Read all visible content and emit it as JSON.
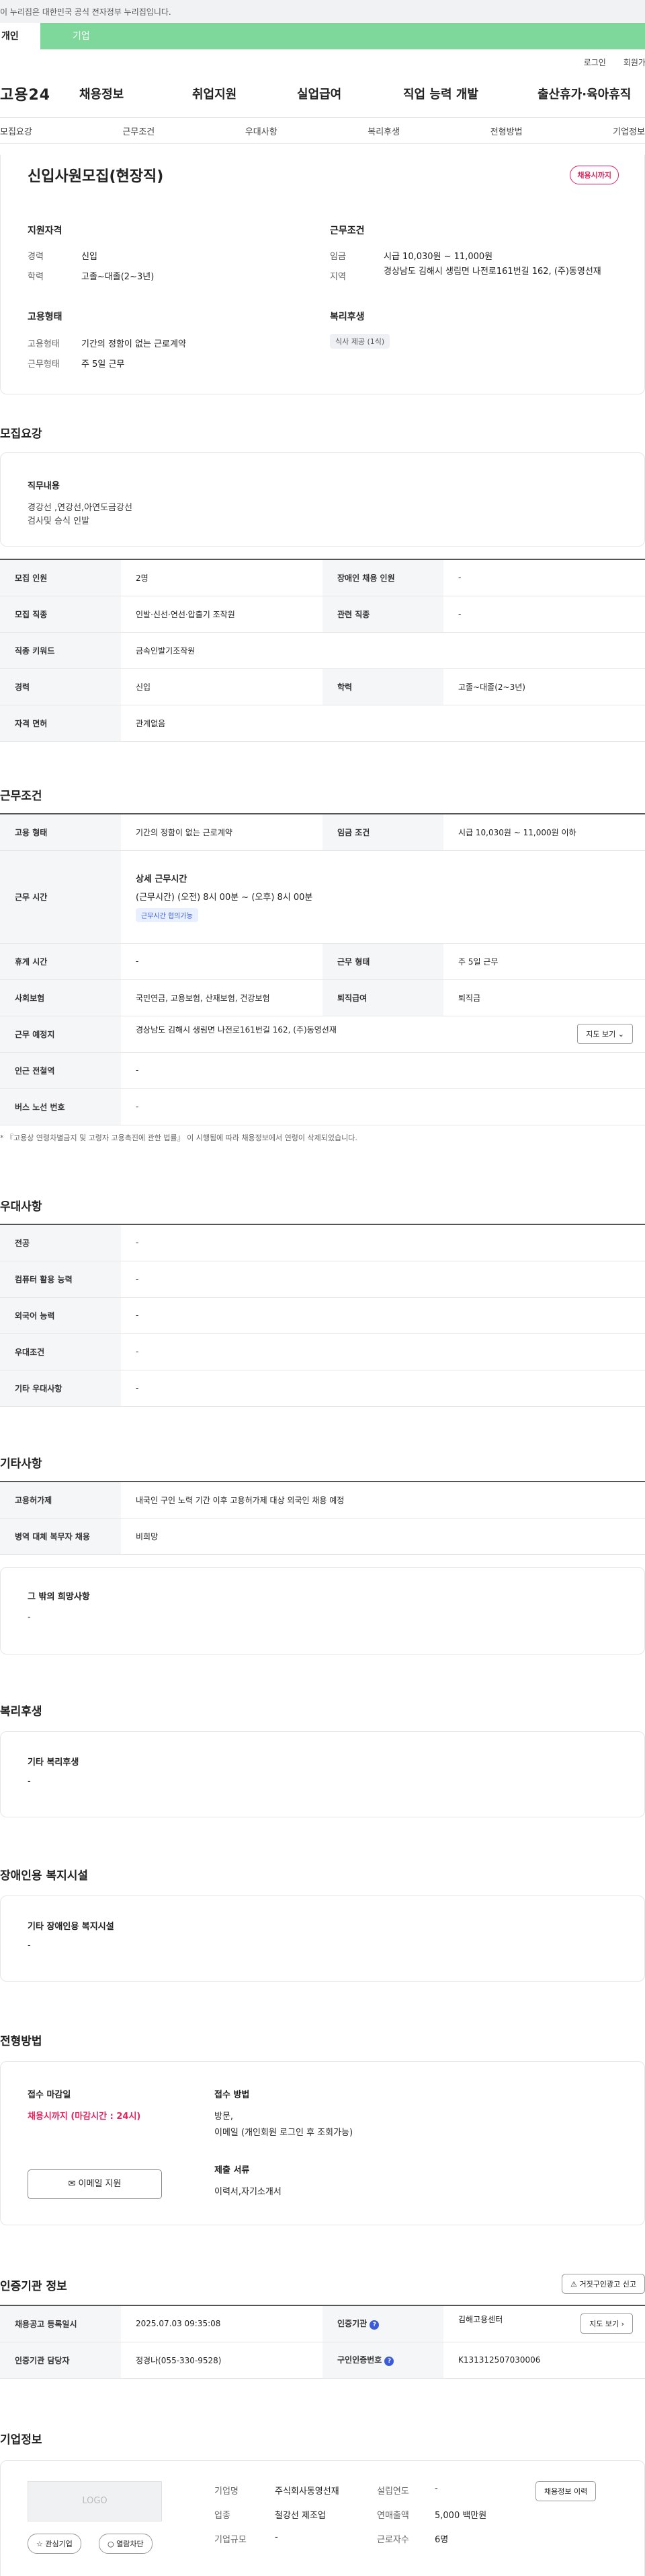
{
  "gov_banner": "이 누리집은 대한민국 공식 전자정부 누리집입니다.",
  "user_tabs": {
    "individual": "개인",
    "corporate": "기업"
  },
  "util": {
    "login": "로그인",
    "join": "회원가입"
  },
  "logo": "고용24",
  "gnb": [
    "채용정보",
    "취업지원",
    "실업급여",
    "직업 능력 개발",
    "출산휴가·육아휴직"
  ],
  "tabs": [
    "모집요강",
    "근무조건",
    "우대사항",
    "복리후생",
    "전형방법",
    "기업정보"
  ],
  "summary": {
    "title": "신입사원모집(현장직)",
    "deadline_badge": "채용시까지",
    "qual_title": "지원자격",
    "cond_title": "근무조건",
    "career_label": "경력",
    "career_value": "신입",
    "edu_label": "학력",
    "edu_value": "고졸~대졸(2~3년)",
    "wage_label": "임금",
    "wage_value": "시급 10,030원 ~ 11,000원",
    "region_label": "지역",
    "region_value": "경상남도 김해시 생림면 나전로161번길 162, (주)동영선재",
    "emp_title": "고용형태",
    "welfare_title": "복리후생",
    "emp_type_label": "고용형태",
    "emp_type_value": "기간의 정함이 없는 근로계약",
    "work_type_label": "근무형태",
    "work_type_value": "주 5일 근무",
    "welfare_chip": "식사 제공 (1식)"
  },
  "recruit": {
    "title": "모집요강",
    "job_title": "직무내용",
    "job_line1": "경강선 ,연강선,아연도금강선",
    "job_line2": "검사및 승식 인발",
    "rows": [
      {
        "k1": "모집 인원",
        "v1": "2명",
        "k2": "장애인 채용 인원",
        "v2": "-"
      },
      {
        "k1": "모집 직종",
        "v1": "인발·신선·연선·압출기 조작원",
        "k2": "관련 직종",
        "v2": "-"
      },
      {
        "k1": "직종 키워드",
        "v1": "금속인발기조작원"
      },
      {
        "k1": "경력",
        "v1": "신입",
        "k2": "학력",
        "v2": "고졸~대졸(2~3년)"
      },
      {
        "k1": "자격 면허",
        "v1": "관계없음"
      }
    ]
  },
  "work": {
    "title": "근무조건",
    "emp_k": "고용 형태",
    "emp_v": "기간의 정함이 없는 근로계약",
    "wage_k": "임금 조건",
    "wage_v": "시급 10,030원 ~ 11,000원 이하",
    "time_k": "근무 시간",
    "time_title": "상세 근무시간",
    "time_v": "(근무시간) (오전) 8시 00분 ~ (오후) 8시 00분",
    "time_chip": "근무시간 협의가능",
    "rest_k": "휴게 시간",
    "rest_v": "-",
    "wtype_k": "근무 형태",
    "wtype_v": "주 5일 근무",
    "ins_k": "사회보험",
    "ins_v": "국민연금, 고용보험, 산재보험, 건강보험",
    "ret_k": "퇴직급여",
    "ret_v": "퇴직금",
    "loc_k": "근무 예정지",
    "loc_v": "경상남도 김해시 생림면 나전로161번길 162, (주)동영선재",
    "map_btn": "지도 보기",
    "sub_k": "인근 전철역",
    "sub_v": "-",
    "bus_k": "버스 노선 번호",
    "bus_v": "-",
    "notice": "* 『고용상 연령차별금지 및 고령자 고용촉진에 관한 법률』 이 시행됨에 따라 채용정보에서 연령이 삭제되었습니다."
  },
  "pref": {
    "title": "우대사항",
    "rows": [
      {
        "k": "전공",
        "v": "-"
      },
      {
        "k": "컴퓨터 활용 능력",
        "v": "-"
      },
      {
        "k": "외국어 능력",
        "v": "-"
      },
      {
        "k": "우대조건",
        "v": "-"
      },
      {
        "k": "기타 우대사항",
        "v": "-"
      }
    ]
  },
  "etc": {
    "title": "기타사항",
    "rows": [
      {
        "k": "고용허가제",
        "v": "내국인 구인 노력 기간 이후 고용허가제 대상 외국인 채용 예정"
      },
      {
        "k": "병역 대체 복무자 채용",
        "v": "비희망"
      }
    ],
    "other_title": "그 밖의 희망사항",
    "other_v": "-"
  },
  "welfare": {
    "title": "복리후생",
    "box_title": "기타 복리후생",
    "box_v": "-"
  },
  "disab": {
    "title": "장애인용 복지시설",
    "box_title": "기타 장애인용 복지시설",
    "box_v": "-"
  },
  "screen": {
    "title": "전형방법",
    "deadline_title": "접수 마감일",
    "deadline_v": "채용시까지 (마감시간 : 24시)",
    "email_btn": "이메일 지원",
    "method_title": "접수 방법",
    "method_v1": "방문,",
    "method_v2": "이메일 (개인회원 로그인 후 조회가능)",
    "docs_title": "제출 서류",
    "docs_v": "이력서,자기소개서"
  },
  "agency": {
    "title": "인증기관 정보",
    "report_btn": "거짓구인광고 신고",
    "reg_k": "채용공고 등록일시",
    "reg_v": "2025.07.03 09:35:08",
    "org_k": "인증기관",
    "org_v": "김해고용센터",
    "map_btn": "지도 보기",
    "mgr_k": "인증기관 담당자",
    "mgr_v": "정경나(055-330-9528)",
    "no_k": "구인인증번호",
    "no_v": "K131312507030006"
  },
  "company": {
    "title": "기업정보",
    "logo_text": "LOGO",
    "fav_btn": "관심기업",
    "block_btn": "열람차단",
    "name_k": "기업명",
    "name_v": "주식회사동영선재",
    "found_k": "설립연도",
    "found_v": "-",
    "ind_k": "업종",
    "ind_v": "철강선 제조업",
    "sales_k": "연매출액",
    "sales_v": "5,000 백만원",
    "size_k": "기업규모",
    "size_v": "-",
    "emp_k": "근로자수",
    "emp_v": "6명",
    "jobs_btn": "채용정보 이력"
  },
  "colors": {
    "accent_green": "#7ed89c",
    "accent_red": "#e0245e",
    "blue": "#3b5bdb"
  }
}
